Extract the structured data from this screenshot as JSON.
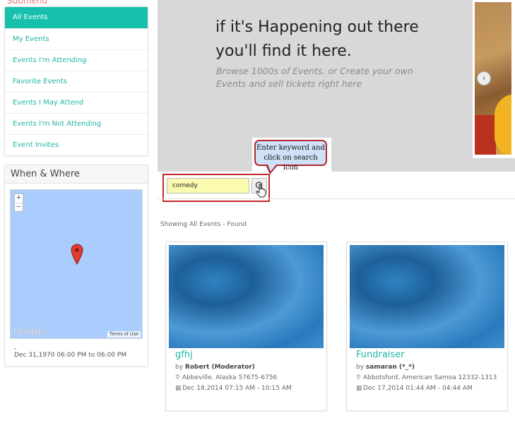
{
  "sidebar": {
    "submenu_label": "Submenu",
    "items": [
      {
        "label": "All Events"
      },
      {
        "label": "My Events"
      },
      {
        "label": "Events I'm Attending"
      },
      {
        "label": "Favorite Events"
      },
      {
        "label": "Events I May Attend"
      },
      {
        "label": "Events I'm Not Attending"
      },
      {
        "label": "Event Invites"
      }
    ],
    "when_where": {
      "title": "When & Where",
      "zoom_in": "+",
      "zoom_out": "−",
      "google": "Google",
      "terms": "Terms of Use",
      "location": ",",
      "date": "Dec 31,1970 06:00 PM to 06:00 PM"
    }
  },
  "hero": {
    "title_line1": "if it's Happening out there",
    "title_line2": "you'll find it here.",
    "subtitle_line1": "Browse 1000s of Events. or Create your own",
    "subtitle_line2": "Events and sell tickets right here"
  },
  "callout": {
    "line1": "Enter keyword and",
    "line2": "click on search icon"
  },
  "search": {
    "value": "comedy"
  },
  "results": {
    "showing_text": "Showing All Events - Found"
  },
  "events": [
    {
      "title": "gfhj",
      "by_prefix": "by",
      "organizer": "Robert (Moderator)",
      "location": "Abbeville, Alaska 57675-6756",
      "date": "Dec 18,2014 07:15 AM - 10:15 AM"
    },
    {
      "title": "Fundraiser",
      "by_prefix": "by",
      "organizer": "samaran (*_*)",
      "location": "Abbotsford, American Samoa 12332-1313",
      "date": "Dec 17,2014 01:44 AM - 04:44 AM"
    }
  ],
  "colors": {
    "accent": "#17c0ad",
    "callout_border": "#b0272f",
    "search_highlight": "#c4262e"
  }
}
